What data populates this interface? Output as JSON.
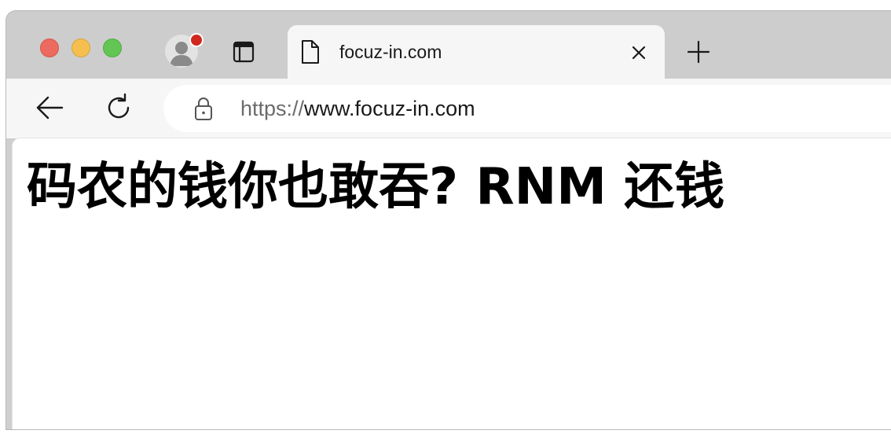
{
  "tab": {
    "title": "focuz-in.com"
  },
  "address_bar": {
    "scheme": "https://",
    "host": "www.focuz-in.com"
  },
  "page": {
    "heading": "码农的钱你也敢吞? RNM 还钱"
  },
  "colors": {
    "close": "#ed6a5e",
    "minimize": "#f5bf4f",
    "zoom": "#62c554",
    "notification_badge": "#d0281e"
  },
  "icons": {
    "profile": "avatar-icon",
    "tab_actions": "tab-actions-icon",
    "tab_page": "document-icon",
    "tab_close": "close-icon",
    "new_tab": "plus-icon",
    "back": "back-arrow-icon",
    "reload": "reload-icon",
    "security": "lock-icon"
  }
}
